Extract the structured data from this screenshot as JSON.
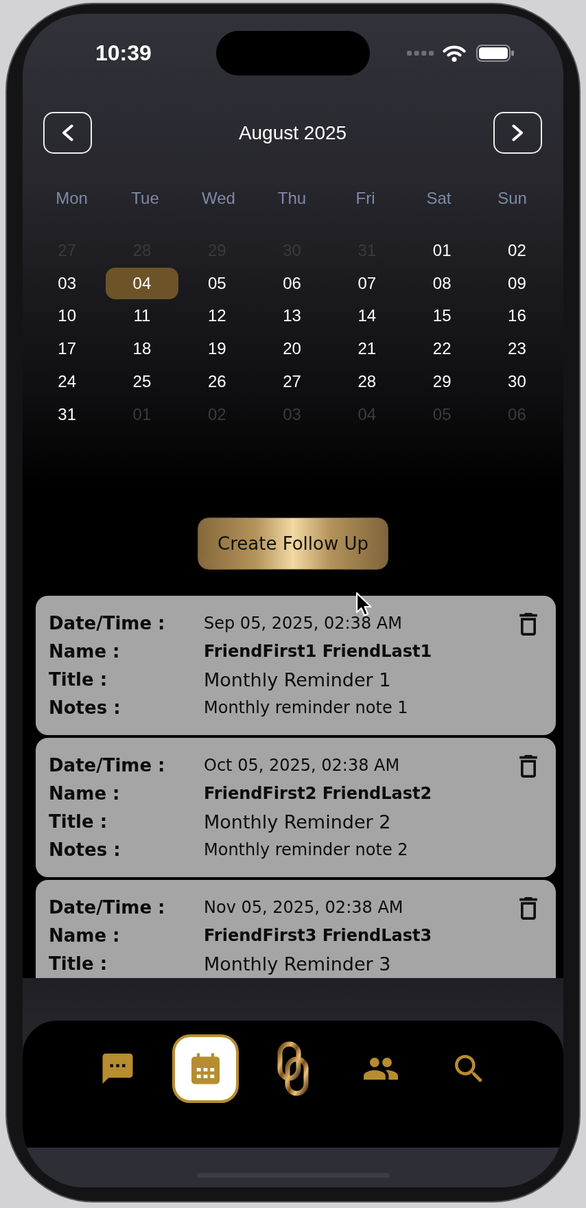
{
  "status_bar": {
    "time": "10:39"
  },
  "calendar": {
    "month_label": "August 2025",
    "weekdays": [
      "Mon",
      "Tue",
      "Wed",
      "Thu",
      "Fri",
      "Sat",
      "Sun"
    ],
    "weeks": [
      [
        {
          "day": "27",
          "in_month": false,
          "selected": false
        },
        {
          "day": "28",
          "in_month": false,
          "selected": false
        },
        {
          "day": "29",
          "in_month": false,
          "selected": false
        },
        {
          "day": "30",
          "in_month": false,
          "selected": false
        },
        {
          "day": "31",
          "in_month": false,
          "selected": false
        },
        {
          "day": "01",
          "in_month": true,
          "selected": false
        },
        {
          "day": "02",
          "in_month": true,
          "selected": false
        }
      ],
      [
        {
          "day": "03",
          "in_month": true,
          "selected": false
        },
        {
          "day": "04",
          "in_month": true,
          "selected": true
        },
        {
          "day": "05",
          "in_month": true,
          "selected": false
        },
        {
          "day": "06",
          "in_month": true,
          "selected": false
        },
        {
          "day": "07",
          "in_month": true,
          "selected": false
        },
        {
          "day": "08",
          "in_month": true,
          "selected": false
        },
        {
          "day": "09",
          "in_month": true,
          "selected": false
        }
      ],
      [
        {
          "day": "10",
          "in_month": true,
          "selected": false
        },
        {
          "day": "11",
          "in_month": true,
          "selected": false
        },
        {
          "day": "12",
          "in_month": true,
          "selected": false
        },
        {
          "day": "13",
          "in_month": true,
          "selected": false
        },
        {
          "day": "14",
          "in_month": true,
          "selected": false
        },
        {
          "day": "15",
          "in_month": true,
          "selected": false
        },
        {
          "day": "16",
          "in_month": true,
          "selected": false
        }
      ],
      [
        {
          "day": "17",
          "in_month": true,
          "selected": false
        },
        {
          "day": "18",
          "in_month": true,
          "selected": false
        },
        {
          "day": "19",
          "in_month": true,
          "selected": false
        },
        {
          "day": "20",
          "in_month": true,
          "selected": false
        },
        {
          "day": "21",
          "in_month": true,
          "selected": false
        },
        {
          "day": "22",
          "in_month": true,
          "selected": false
        },
        {
          "day": "23",
          "in_month": true,
          "selected": false
        }
      ],
      [
        {
          "day": "24",
          "in_month": true,
          "selected": false
        },
        {
          "day": "25",
          "in_month": true,
          "selected": false
        },
        {
          "day": "26",
          "in_month": true,
          "selected": false
        },
        {
          "day": "27",
          "in_month": true,
          "selected": false
        },
        {
          "day": "28",
          "in_month": true,
          "selected": false
        },
        {
          "day": "29",
          "in_month": true,
          "selected": false
        },
        {
          "day": "30",
          "in_month": true,
          "selected": false
        }
      ],
      [
        {
          "day": "31",
          "in_month": true,
          "selected": false
        },
        {
          "day": "01",
          "in_month": false,
          "selected": false
        },
        {
          "day": "02",
          "in_month": false,
          "selected": false
        },
        {
          "day": "03",
          "in_month": false,
          "selected": false
        },
        {
          "day": "04",
          "in_month": false,
          "selected": false
        },
        {
          "day": "05",
          "in_month": false,
          "selected": false
        },
        {
          "day": "06",
          "in_month": false,
          "selected": false
        }
      ]
    ]
  },
  "create_button": {
    "label": "Create Follow Up"
  },
  "follow_ups": [
    {
      "fields": [
        {
          "kind": "datetime",
          "label": "Date/Time :",
          "value": "Sep 05, 2025, 02:38 AM"
        },
        {
          "kind": "name",
          "label": "Name :",
          "value": "FriendFirst1 FriendLast1"
        },
        {
          "kind": "title",
          "label": "Title :",
          "value": "Monthly Reminder 1"
        },
        {
          "kind": "notes",
          "label": "Notes :",
          "value": "Monthly reminder note 1"
        }
      ]
    },
    {
      "fields": [
        {
          "kind": "datetime",
          "label": "Date/Time :",
          "value": "Oct 05, 2025, 02:38 AM"
        },
        {
          "kind": "name",
          "label": "Name :",
          "value": "FriendFirst2 FriendLast2"
        },
        {
          "kind": "title",
          "label": "Title :",
          "value": "Monthly Reminder 2"
        },
        {
          "kind": "notes",
          "label": "Notes :",
          "value": "Monthly reminder note 2"
        }
      ]
    },
    {
      "fields": [
        {
          "kind": "datetime",
          "label": "Date/Time :",
          "value": "Nov 05, 2025, 02:38 AM"
        },
        {
          "kind": "name",
          "label": "Name :",
          "value": "FriendFirst3 FriendLast3"
        },
        {
          "kind": "title",
          "label": "Title :",
          "value": "Monthly Reminder 3"
        }
      ]
    }
  ],
  "nav": {
    "items": [
      {
        "kind": "messages",
        "selected": false
      },
      {
        "kind": "calendar",
        "selected": true
      },
      {
        "kind": "logo",
        "selected": false
      },
      {
        "kind": "contacts",
        "selected": false
      },
      {
        "kind": "search",
        "selected": false
      }
    ]
  }
}
